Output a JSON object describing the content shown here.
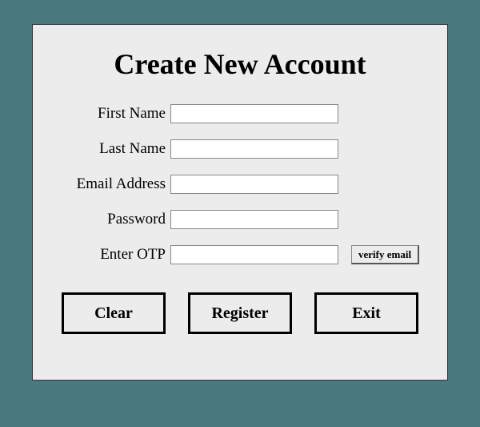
{
  "title": "Create New Account",
  "fields": {
    "firstName": {
      "label": "First Name",
      "value": ""
    },
    "lastName": {
      "label": "Last Name",
      "value": ""
    },
    "email": {
      "label": "Email Address",
      "value": ""
    },
    "password": {
      "label": "Password",
      "value": ""
    },
    "otp": {
      "label": "Enter OTP",
      "value": ""
    }
  },
  "buttons": {
    "verifyEmail": "verify email",
    "clear": "Clear",
    "register": "Register",
    "exit": "Exit"
  }
}
